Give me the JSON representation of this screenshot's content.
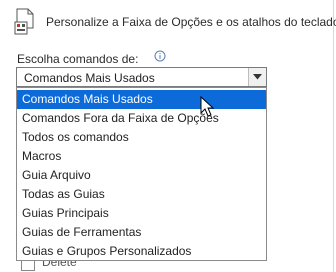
{
  "header": {
    "description": "Personalize a Faixa de Opções e os atalhos do teclado.",
    "icon": "customize-ribbon-icon"
  },
  "commands": {
    "label": "Escolha comandos de:",
    "info_icon": "info-icon",
    "selected_value": "Comandos Mais Usados",
    "options": [
      "Comandos Mais Usados",
      "Comandos Fora da Faixa de Opções",
      "Todos os comandos",
      "Macros",
      "Guia Arquivo",
      "Todas as Guias",
      "Guias Principais",
      "Guias de Ferramentas",
      "Guias e Grupos Personalizados"
    ],
    "highlighted_index": 0
  },
  "underlying_list": {
    "partial_item": "Delete"
  },
  "colors": {
    "selection": "#0c6ad9",
    "border": "#7a7a7a"
  }
}
